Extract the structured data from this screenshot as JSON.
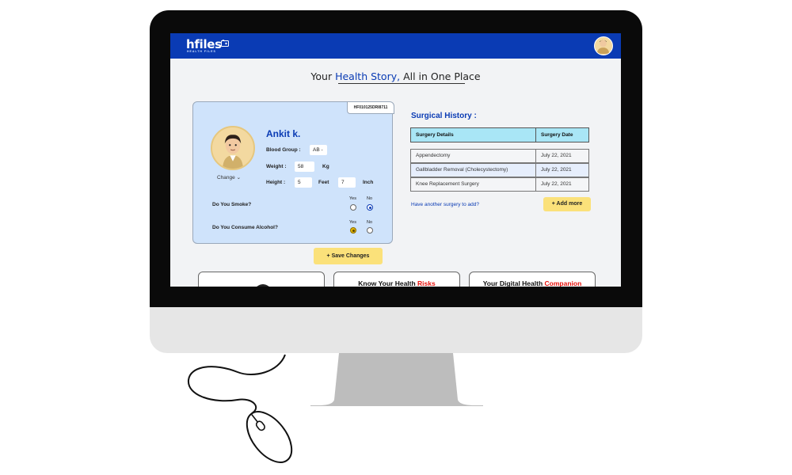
{
  "header": {
    "logo": "hfiles",
    "logo_sub": "HEALTH FILES"
  },
  "page_title": {
    "prefix": "Your ",
    "accent": "Health Story,",
    "suffix": " All in One Place"
  },
  "profile": {
    "id": "HF010125DRI8711",
    "name": "Ankit k.",
    "change_label": "Change",
    "blood_group_label": "Blood Group :",
    "blood_group_value": "AB -",
    "weight_label": "Weight :",
    "weight_value": "58",
    "weight_unit": "Kg",
    "height_label": "Height :",
    "height_feet": "5",
    "feet_label": "Feet",
    "height_inch": "7",
    "inch_label": "Inch",
    "smoke_question": "Do You Smoke?",
    "alcohol_question": "Do You Consume Alcohol?",
    "yes_label": "Yes",
    "no_label": "No",
    "smoke_answer": "No",
    "alcohol_answer": "Yes"
  },
  "save_button": "+ Save Changes",
  "surgical_history": {
    "title": "Surgical History :",
    "columns": [
      "Surgery Details",
      "Surgery Date"
    ],
    "rows": [
      {
        "details": "Appendectomy",
        "date": "July 22, 2021"
      },
      {
        "details": "Gallbladder Removal (Cholecystectomy)",
        "date": "July 22, 2021"
      },
      {
        "details": "Knee Replacement Surgery",
        "date": "July 22, 2021"
      }
    ],
    "add_prompt": "Have another surgery to add?",
    "add_button": "+ Add more"
  },
  "bottom_cards": [
    {
      "title": "",
      "accent": ""
    },
    {
      "title": "Know Your Health ",
      "accent": "Risks"
    },
    {
      "title": "Your Digital Health ",
      "accent": "Companion"
    }
  ],
  "colors": {
    "brand_blue": "#0a3bb4",
    "card_blue": "#cfe3fb",
    "button_yellow": "#fbe17a",
    "table_header": "#a9e6f6",
    "accent_red": "#e8120c"
  }
}
